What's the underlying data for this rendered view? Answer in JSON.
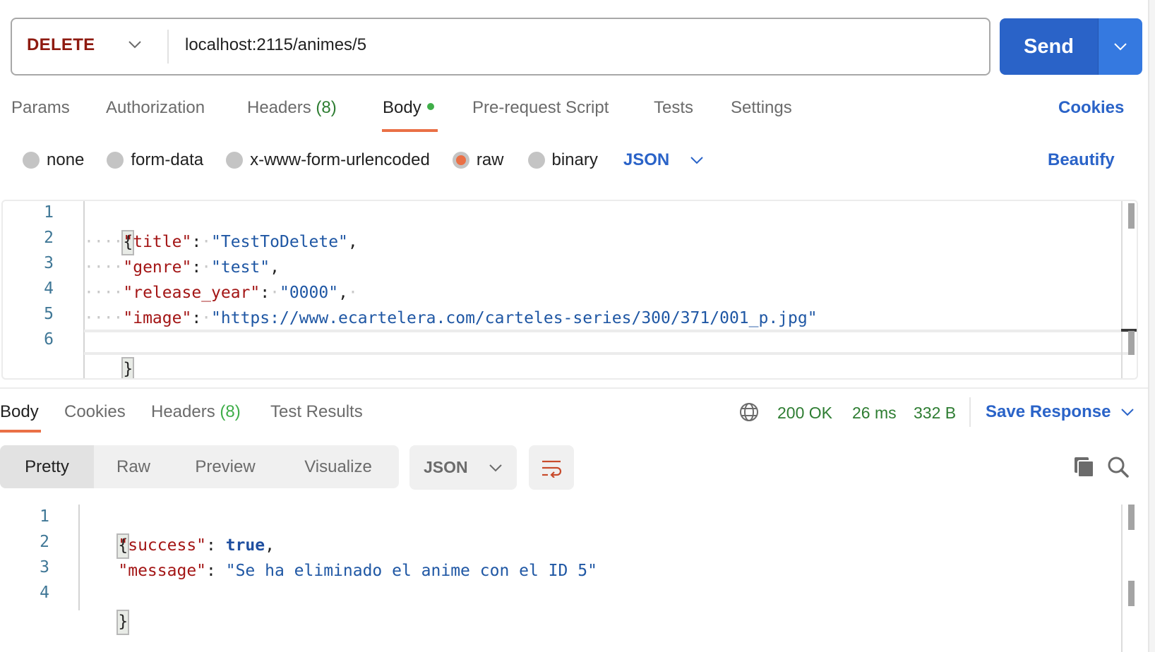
{
  "request": {
    "method": "DELETE",
    "url": "localhost:2115/animes/5",
    "send_label": "Send",
    "method_color": "#8e1a10",
    "accent_color": "#2a63c8"
  },
  "request_tabs": {
    "params": "Params",
    "authorization": "Authorization",
    "headers": "Headers",
    "headers_count": "(8)",
    "body": "Body",
    "prerequest": "Pre-request Script",
    "tests": "Tests",
    "settings": "Settings",
    "active": "Body",
    "cookies_link": "Cookies"
  },
  "body_types": {
    "none": "none",
    "form_data": "form-data",
    "urlencoded": "x-www-form-urlencoded",
    "raw": "raw",
    "binary": "binary",
    "selected": "raw",
    "language": "JSON",
    "beautify": "Beautify"
  },
  "request_body": {
    "line_numbers": [
      "1",
      "2",
      "3",
      "4",
      "5",
      "6"
    ],
    "open_brace": "{",
    "close_brace": "}",
    "fields": [
      {
        "key": "\"title\"",
        "value": "\"TestToDelete\"",
        "trail": ","
      },
      {
        "key": "\"genre\"",
        "value": "\"test\"",
        "trail": ","
      },
      {
        "key": "\"release_year\"",
        "value": "\"0000\"",
        "trail": ","
      },
      {
        "key": "\"image\"",
        "value": "\"https://www.ecartelera.com/carteles-series/300/371/001_p.jpg\"",
        "trail": ""
      }
    ]
  },
  "response_tabs": {
    "body": "Body",
    "cookies": "Cookies",
    "headers": "Headers",
    "headers_count": "(8)",
    "test_results": "Test Results",
    "active": "Body"
  },
  "response_status": {
    "status": "200 OK",
    "time": "26 ms",
    "size": "332 B",
    "save_response": "Save Response",
    "status_color": "#2e7d32"
  },
  "response_view": {
    "modes": [
      "Pretty",
      "Raw",
      "Preview",
      "Visualize"
    ],
    "active_mode": "Pretty",
    "format": "JSON"
  },
  "response_body": {
    "line_numbers": [
      "1",
      "2",
      "3",
      "4"
    ],
    "open_brace": "{",
    "close_brace": "}",
    "fields": [
      {
        "key": "\"success\"",
        "value": "true",
        "value_type": "boolean",
        "trail": ","
      },
      {
        "key": "\"message\"",
        "value": "\"Se ha eliminado el anime con el ID 5\"",
        "value_type": "string",
        "trail": ""
      }
    ]
  }
}
